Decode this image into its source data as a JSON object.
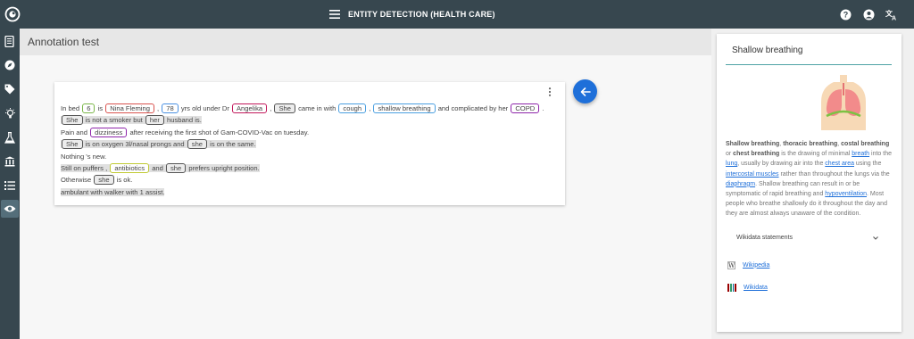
{
  "app": {
    "title": "ENTITY DETECTION (HEALTH CARE)",
    "icons": [
      "logo-icon",
      "menu-icon",
      "help-icon",
      "account-icon",
      "translate-icon"
    ]
  },
  "sidebar": {
    "items": [
      "document-icon",
      "compass-icon",
      "tag-icon",
      "lightbulb-icon",
      "flask-icon",
      "museum-icon",
      "list-icon",
      "eye-icon"
    ],
    "active": "eye-icon"
  },
  "header": {
    "title": "Annotation test"
  },
  "annotation": {
    "lines": [
      {
        "shaded": false,
        "parts": [
          {
            "t": "In bed "
          },
          {
            "e": "6",
            "type": "num"
          },
          {
            "t": " is "
          },
          {
            "e": "Nina Fleming",
            "type": "person"
          },
          {
            "t": " , "
          },
          {
            "e": "78",
            "type": "age"
          },
          {
            "t": " yrs old under Dr "
          },
          {
            "e": "Angelika",
            "type": "doc"
          },
          {
            "t": " , "
          },
          {
            "e": "She",
            "type": "pron"
          },
          {
            "t": " came in with "
          },
          {
            "e": "cough",
            "type": "symptom"
          },
          {
            "t": " , "
          },
          {
            "e": "shallow breathing",
            "type": "symptom"
          },
          {
            "t": " and complicated by her "
          },
          {
            "e": "COPD",
            "type": "disease"
          },
          {
            "t": " ."
          }
        ]
      },
      {
        "shaded": true,
        "parts": [
          {
            "e": "She",
            "type": "pron"
          },
          {
            "t": " is not a smoker but "
          },
          {
            "e": "her",
            "type": "pron"
          },
          {
            "t": " husband is."
          }
        ]
      },
      {
        "shaded": false,
        "parts": [
          {
            "t": "Pain and "
          },
          {
            "e": "dizziness",
            "type": "disease"
          },
          {
            "t": " after receiving the first shot of Gam-COVID-Vac on tuesday."
          }
        ]
      },
      {
        "shaded": true,
        "parts": [
          {
            "e": "She",
            "type": "pron"
          },
          {
            "t": " is on oxygen 3l/nasal prongs and "
          },
          {
            "e": "she",
            "type": "pron"
          },
          {
            "t": " is on the same."
          }
        ]
      },
      {
        "shaded": false,
        "parts": [
          {
            "t": "Nothing 's new."
          }
        ]
      },
      {
        "shaded": true,
        "parts": [
          {
            "t": "Still on puffers , "
          },
          {
            "e": "antibiotics",
            "type": "drug"
          },
          {
            "t": " and "
          },
          {
            "e": "she",
            "type": "pron"
          },
          {
            "t": " prefers upright position."
          }
        ]
      },
      {
        "shaded": false,
        "parts": [
          {
            "t": "Otherwise "
          },
          {
            "e": "she",
            "type": "pron"
          },
          {
            "t": " is ok."
          }
        ]
      },
      {
        "shaded": true,
        "parts": [
          {
            "t": "ambulant with walker with 1 assist."
          }
        ]
      }
    ]
  },
  "panel": {
    "title": "Shallow breathing",
    "wikidata_label": "Wikidata statements",
    "links": [
      {
        "icon": "wikipedia-icon",
        "label": "Wikipedia"
      },
      {
        "icon": "wikidata-icon",
        "label": "Wikidata"
      }
    ],
    "colors": {
      "accent": "#4fa3a5",
      "fab": "#1e6fd9",
      "topbar": "#37474f"
    }
  }
}
